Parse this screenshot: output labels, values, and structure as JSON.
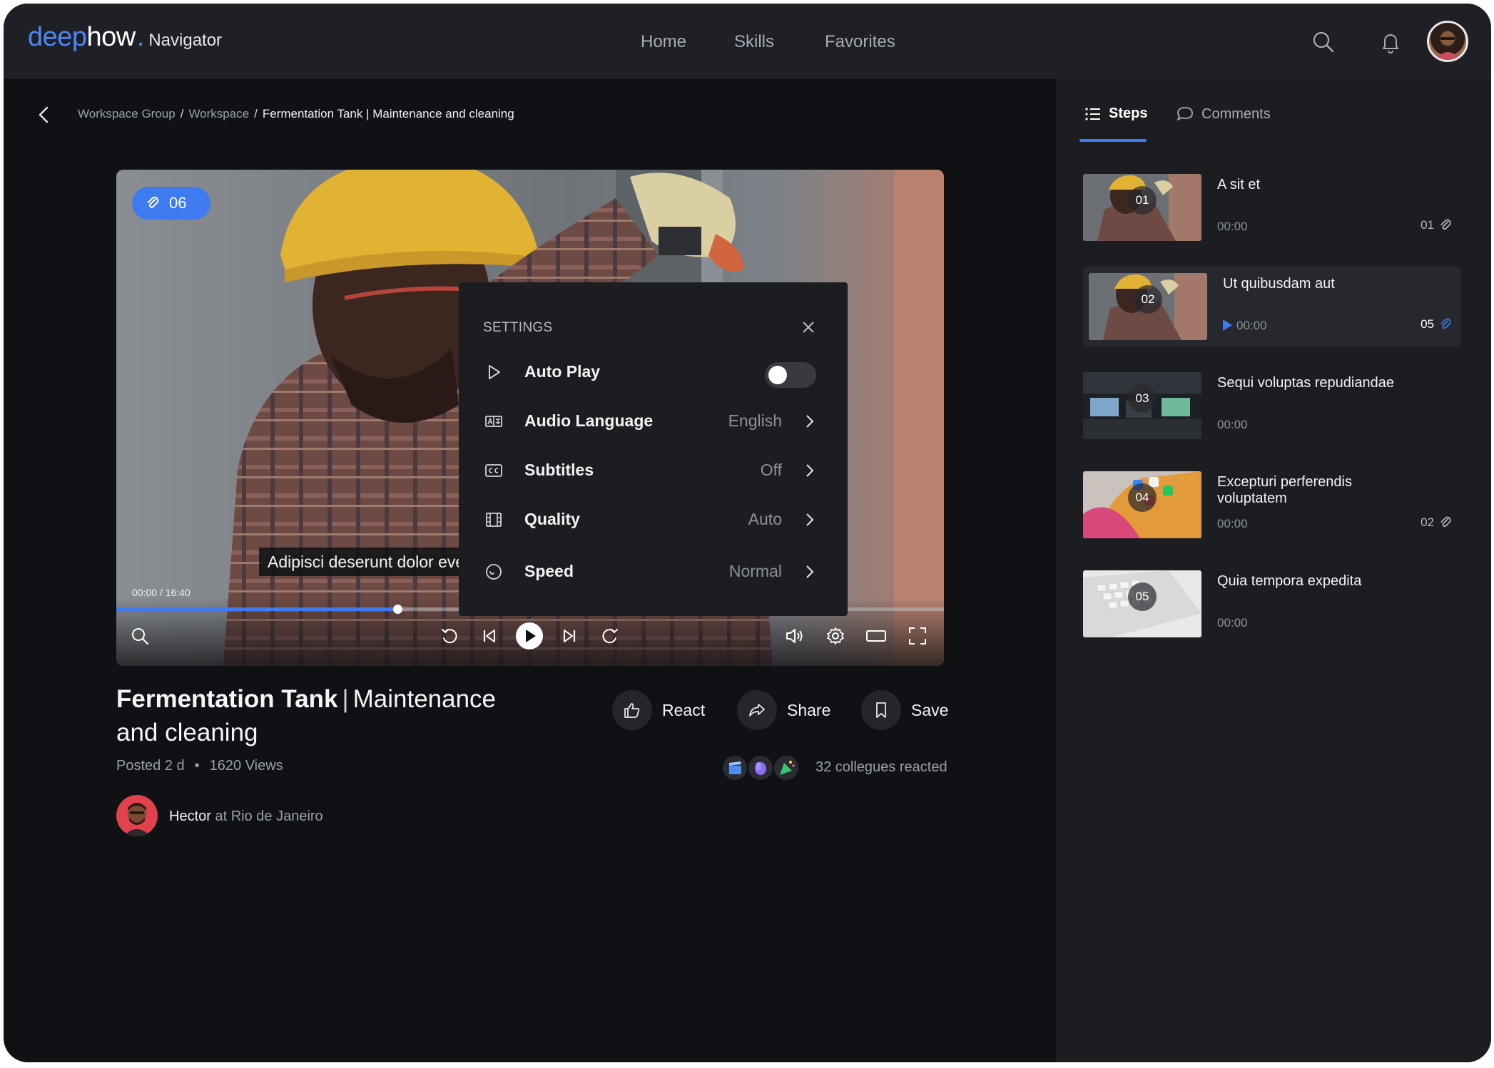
{
  "app": {
    "logo_primary": "deep",
    "logo_secondary": "how",
    "logo_dot": ".",
    "logo_product": "Navigator",
    "nav": [
      "Home",
      "Skills",
      "Favorites"
    ],
    "accent_color": "#3f7bf0"
  },
  "breadcrumb": {
    "items": [
      "Workspace Group",
      "Workspace",
      "Fermentation Tank | Maintenance and cleaning"
    ],
    "separator": "/"
  },
  "video": {
    "attachment_count": "06",
    "caption": "Adipisci deserunt dolor eve",
    "timecode": "00:00 / 16:40",
    "progress_fraction": 0.34
  },
  "settings": {
    "title": "SETTINGS",
    "rows": [
      {
        "label": "Auto Play",
        "icon": "play-outline-icon",
        "toggle_on": false
      },
      {
        "label": "Audio Language",
        "value": "English",
        "icon": "audio-language-icon"
      },
      {
        "label": "Subtitles",
        "value": "Off",
        "icon": "closed-captions-icon"
      },
      {
        "label": "Quality",
        "value": "Auto",
        "icon": "film-icon"
      },
      {
        "label": "Speed",
        "value": "Normal",
        "icon": "speedometer-icon"
      }
    ]
  },
  "details": {
    "title_bold": "Fermentation Tank",
    "title_sep": "|",
    "title_rest": "Maintenance and cleaning",
    "posted": "Posted 2 d",
    "bullet": "•",
    "views": "1620 Views",
    "actions": {
      "react": "React",
      "share": "Share",
      "save": "Save"
    },
    "reacted_text": "32 collegues reacted",
    "author_name": "Hector",
    "author_location": "at Rio de Janeiro"
  },
  "sidebar": {
    "tabs": {
      "steps": "Steps",
      "comments": "Comments"
    },
    "steps": [
      {
        "num": "01",
        "title": "A sit et",
        "time": "00:00",
        "attachments": "01",
        "active": false,
        "playing": false
      },
      {
        "num": "02",
        "title": "Ut quibusdam aut",
        "time": "00:00",
        "attachments": "05",
        "active": true,
        "playing": true
      },
      {
        "num": "03",
        "title": "Sequi voluptas repudiandae",
        "time": "00:00",
        "attachments": "",
        "active": false,
        "playing": false
      },
      {
        "num": "04",
        "title": "Excepturi perferendis voluptatem",
        "time": "00:00",
        "attachments": "02",
        "active": false,
        "playing": false
      },
      {
        "num": "05",
        "title": "Quia tempora expedita",
        "time": "00:00",
        "attachments": "",
        "active": false,
        "playing": false
      }
    ]
  }
}
